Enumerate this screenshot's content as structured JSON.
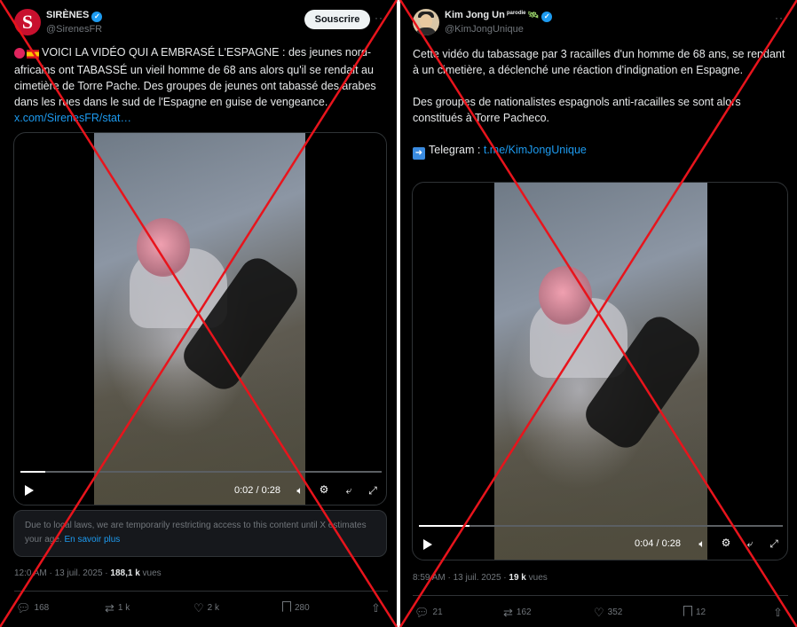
{
  "left_post": {
    "author_name": "SIRÈNES",
    "author_handle": "@SirenesFR",
    "avatar_letter": "S",
    "subscribe_label": "Souscrire",
    "more_label": "···",
    "text": "VOICI LA VIDÉO QUI A EMBRASÉ L'ESPAGNE : des jeunes nord-africains ont TABASSÉ un vieil homme de 68 ans alors qu'il se rendait au cimetière de Torre Pache. Des groupes de jeunes ont tabassé des arabes dans les rues dans le sud de l'Espagne en guise de vengeance.",
    "link": "x.com/SirenesFR/stat…",
    "video": {
      "time": "0:02 / 0:28",
      "progress": 0.07
    },
    "restriction_text": "Due to local laws, we are temporarily restricting access to this content until X estimates your age.",
    "restriction_link": "En savoir plus",
    "timestamp": "12:0 AM · 13 juil. 2025 · ",
    "views_count": "188,1 k",
    "views_label": " vues",
    "replies": "168",
    "reposts": "1 k",
    "likes": "2 k",
    "bookmarks": "280"
  },
  "right_post": {
    "author_name": "Kim Jong Un",
    "parody_tag": "parodie",
    "author_handle": "@KimJongUnique",
    "more_label": "···",
    "text_p1": "Cette vidéo du tabassage par 3 racailles d'un homme de 68 ans, se rendant à un cimetière, a déclenché une réaction d'indignation en Espagne.",
    "text_p2": "Des groupes de nationalistes espagnols anti-racailles se sont alors constitués à Torre Pacheco.",
    "telegram_label": "Telegram : ",
    "telegram_link": "t.me/KimJongUnique",
    "video": {
      "time": "0:04 / 0:28",
      "progress": 0.14
    },
    "timestamp": "8:59 AM · 13 juil. 2025 · ",
    "views_count": "19 k",
    "views_label": " vues",
    "replies": "21",
    "reposts": "162",
    "likes": "352",
    "bookmarks": "12"
  },
  "colors": {
    "background": "#000000",
    "text": "#e7e9ea",
    "muted": "#71767b",
    "link": "#1d9bf0",
    "cross": "#e8141c"
  },
  "icons": [
    "reply-icon",
    "repost-icon",
    "like-icon",
    "bookmark-icon",
    "share-icon",
    "play-icon",
    "volume-icon",
    "settings-icon",
    "pip-icon",
    "fullscreen-icon",
    "verified-icon",
    "telegram-arrow-icon"
  ]
}
